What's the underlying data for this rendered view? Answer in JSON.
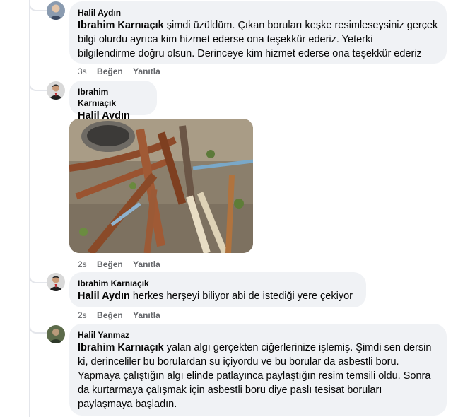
{
  "comments": [
    {
      "author": "Halil Aydın",
      "mention": "Ibrahim Karnıaçık",
      "lines": [
        " şimdi üzüldüm. Çıkan boruları keşke resimleseysiniz gerçek",
        "bilgi olurdu ayrıca kim hizmet ederse ona teşekkür ederiz. Yeterki",
        "bilgilendirme doğru olsun. Derinceye kim hizmet ederse ona teşekkür ederiz"
      ],
      "time": "3s",
      "like": "Beğen",
      "reply": "Yanıtla"
    },
    {
      "author": "Ibrahim Karnıaçık",
      "mention": "Halil Aydın",
      "lines": [
        ""
      ],
      "time": "2s",
      "like": "Beğen",
      "reply": "Yanıtla"
    },
    {
      "author": "Ibrahim Karnıaçık",
      "mention": "Halil Aydın",
      "lines": [
        " herkes herşeyi biliyor abi de istediği yere çekiyor"
      ],
      "time": "2s",
      "like": "Beğen",
      "reply": "Yanıtla"
    },
    {
      "author": "Halil Yanmaz",
      "mention": "Ibrahim Karnıaçık",
      "lines": [
        " yalan algı gerçekten ciğerlerinize işlemiş. Şimdi sen dersin",
        "ki, derinceliler bu borulardan su içiyordu ve bu borular da asbestli boru.",
        "Yapmaya çalıştığın algı elinde patlayınca paylaştığın resim temsili oldu. Sonra",
        "da kurtarmaya çalışmak için asbestli boru diye paslı tesisat boruları",
        "paylaşmaya başladın."
      ]
    }
  ],
  "colors": {
    "bubble": "#f0f2f5",
    "meta": "#65676b",
    "thread": "#e4e6eb"
  }
}
